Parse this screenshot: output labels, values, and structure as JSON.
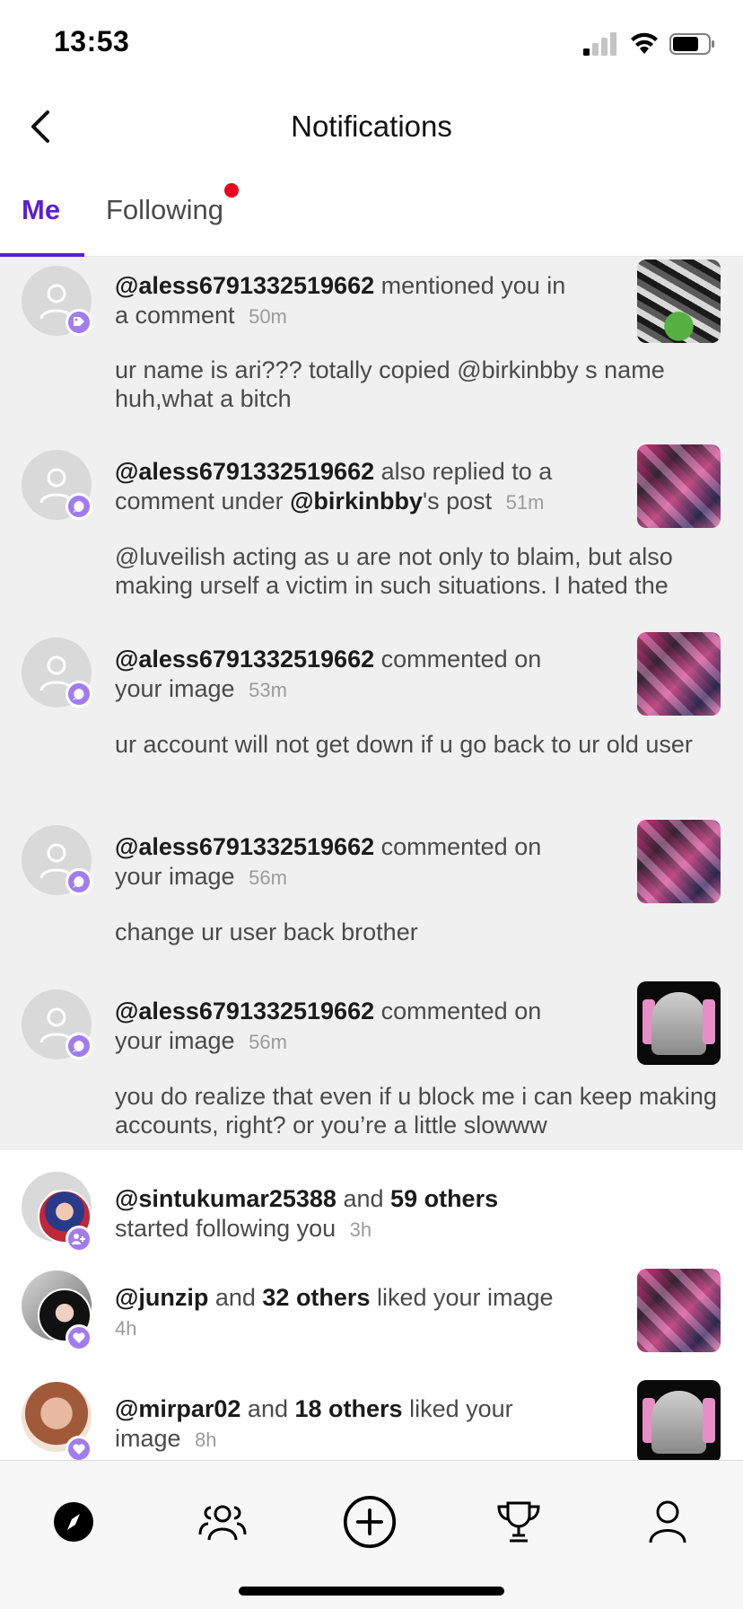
{
  "status_bar": {
    "time": "13:53"
  },
  "header": {
    "title": "Notifications"
  },
  "tabs": [
    {
      "label": "Me",
      "active": true
    },
    {
      "label": "Following",
      "has_dot": true
    }
  ],
  "notifications": [
    {
      "user": "@aless6791332519662",
      "action": "mentioned you in a comment",
      "time": "50m",
      "comment": "ur name is ari??? totally copied @birkinbby s name huh,what a bitch",
      "badge_icon": "tag-icon",
      "thumb": "collage-green"
    },
    {
      "user": "@aless6791332519662",
      "action_pre": "also replied to a comment under",
      "target": "@birkinbby",
      "action_post": "'s post",
      "time": "51m",
      "comment": "@luveilish acting as u are not only to blaim, but also making urself a victim in such situations. I hated the",
      "badge_icon": "comment-icon",
      "thumb": "collage-pink"
    },
    {
      "user": "@aless6791332519662",
      "action": "commented on your image",
      "time": "53m",
      "comment": "ur account will not get down if u go back to ur old user",
      "badge_icon": "comment-icon",
      "thumb": "collage-pink"
    },
    {
      "user": "@aless6791332519662",
      "action": "commented on your image",
      "time": "56m",
      "comment": "change ur user back brother",
      "badge_icon": "comment-icon",
      "thumb": "collage-pink"
    },
    {
      "user": "@aless6791332519662",
      "action": "commented on your image",
      "time": "56m",
      "comment": "you do realize that even if u block me i can keep making accounts, right? or you’re a little slowww",
      "badge_icon": "comment-icon",
      "thumb": "dark-portrait"
    },
    {
      "user": "@sintukumar25388",
      "joiner": "and",
      "others": "59 others",
      "action": "started following you",
      "time": "3h",
      "badge_icon": "follow-icon"
    },
    {
      "user": "@junzip",
      "joiner": "and",
      "others": "32 others",
      "action": "liked your image",
      "time": "4h",
      "badge_icon": "heart-icon",
      "thumb": "collage-pink"
    },
    {
      "user": "@mirpar02",
      "joiner": "and",
      "others": "18 others",
      "action": "liked your image",
      "time": "8h",
      "badge_icon": "heart-icon",
      "thumb": "dark-portrait"
    }
  ],
  "bottom_nav": [
    {
      "icon": "explore-icon",
      "active": true
    },
    {
      "icon": "community-icon"
    },
    {
      "icon": "create-icon"
    },
    {
      "icon": "trophy-icon"
    },
    {
      "icon": "profile-icon"
    }
  ],
  "colors": {
    "accent": "#5b1fd0",
    "badge": "#a07cf0",
    "unread_bg": "#f0f0f0",
    "dot": "#e8001c"
  }
}
